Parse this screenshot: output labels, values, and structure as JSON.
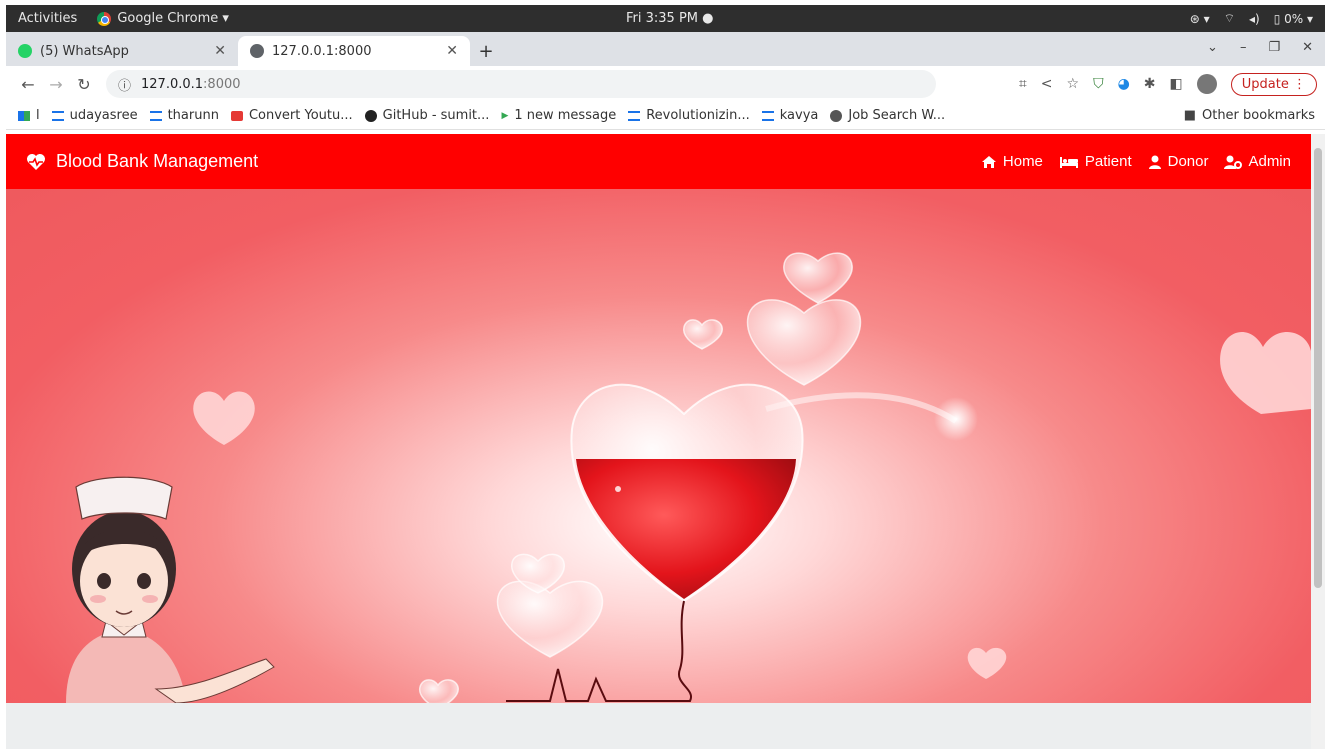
{
  "system_bar": {
    "activities": "Activities",
    "app_name": "Google Chrome ▾",
    "clock": "Fri 3:35 PM ●",
    "battery": "0%"
  },
  "tabs": [
    {
      "label": "(5) WhatsApp",
      "icon": "whatsapp-icon",
      "active": false
    },
    {
      "label": "127.0.0.1:8000",
      "icon": "globe-icon",
      "active": true
    }
  ],
  "address_bar": {
    "info_glyph": "ⓘ",
    "host": "127.0.0.1",
    "port": ":8000",
    "update_label": "Update"
  },
  "bookmarks": [
    {
      "label": "l",
      "icon": "app-icon"
    },
    {
      "label": "udayasree",
      "icon": "bookmark-icon"
    },
    {
      "label": "tharunn",
      "icon": "bookmark-icon"
    },
    {
      "label": "Convert Youtu...",
      "icon": "youtube-icon"
    },
    {
      "label": "GitHub - sumit...",
      "icon": "github-icon"
    },
    {
      "label": "1 new message",
      "icon": "play-icon"
    },
    {
      "label": "Revolutionizin...",
      "icon": "bookmark-icon"
    },
    {
      "label": "kavya",
      "icon": "bookmark-icon"
    },
    {
      "label": "Job Search W...",
      "icon": "globe-icon"
    }
  ],
  "other_bookmarks": "Other bookmarks",
  "site": {
    "brand": "Blood Bank Management",
    "brand_icon": "heartbeat-icon",
    "nav": [
      {
        "label": "Home",
        "icon": "home-icon"
      },
      {
        "label": "Patient",
        "icon": "bed-icon"
      },
      {
        "label": "Donor",
        "icon": "user-icon"
      },
      {
        "label": "Admin",
        "icon": "user-cog-icon"
      }
    ],
    "colors": {
      "navbar": "#ff0000",
      "hero": "#ef5a5e"
    }
  }
}
